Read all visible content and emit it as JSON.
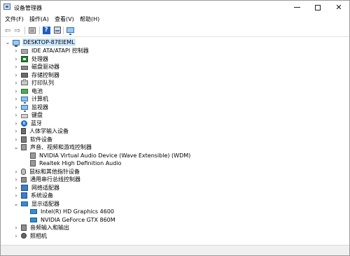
{
  "window": {
    "title": "设备管理器",
    "icon": "device-manager-icon",
    "controls": {
      "minimize": "minimize-icon",
      "maximize": "maximize-icon",
      "close": "✕"
    }
  },
  "menu": [
    "文件(F)",
    "操作(A)",
    "查看(V)",
    "帮助(H)"
  ],
  "toolbar": {
    "buttons": [
      "back-arrow-icon",
      "forward-arrow-icon",
      "properties-icon",
      "help-icon",
      "scan-hardware-icon",
      "monitor-icon"
    ],
    "back_glyph": "⇦",
    "forward_glyph": "⇨",
    "help_glyph": "?"
  },
  "tree": {
    "root": {
      "label": "DESKTOP-87EIEML",
      "expanded": true
    },
    "items": [
      {
        "label": "IDE ATA/ATAPI 控制器",
        "icon": "ide-controller-icon",
        "expanded": false
      },
      {
        "label": "处理器",
        "icon": "processor-icon",
        "expanded": false
      },
      {
        "label": "磁盘驱动器",
        "icon": "disk-drive-icon",
        "expanded": false
      },
      {
        "label": "存储控制器",
        "icon": "storage-controller-icon",
        "expanded": false
      },
      {
        "label": "打印队列",
        "icon": "printer-icon",
        "expanded": false
      },
      {
        "label": "电池",
        "icon": "battery-icon",
        "expanded": false
      },
      {
        "label": "计算机",
        "icon": "computer-icon",
        "expanded": false
      },
      {
        "label": "监视器",
        "icon": "monitor-icon",
        "expanded": false
      },
      {
        "label": "键盘",
        "icon": "keyboard-icon",
        "expanded": false
      },
      {
        "label": "蓝牙",
        "icon": "bluetooth-icon",
        "expanded": false
      },
      {
        "label": "人体学输入设备",
        "icon": "hid-icon",
        "expanded": false
      },
      {
        "label": "软件设备",
        "icon": "software-device-icon",
        "expanded": false
      },
      {
        "label": "声音、视频和游戏控制器",
        "icon": "sound-icon",
        "expanded": true,
        "children": [
          {
            "label": "NVIDIA Virtual Audio Device (Wave Extensible) (WDM)",
            "icon": "speaker-icon"
          },
          {
            "label": "Realtek High Definition Audio",
            "icon": "speaker-icon"
          }
        ]
      },
      {
        "label": "鼠标和其他指针设备",
        "icon": "mouse-icon",
        "expanded": false
      },
      {
        "label": "通用串行总线控制器",
        "icon": "usb-icon",
        "expanded": false
      },
      {
        "label": "网络适配器",
        "icon": "network-adapter-icon",
        "expanded": false
      },
      {
        "label": "系统设备",
        "icon": "system-device-icon",
        "expanded": false
      },
      {
        "label": "显示适配器",
        "icon": "display-adapter-icon",
        "expanded": true,
        "children": [
          {
            "label": "Intel(R) HD Graphics 4600",
            "icon": "display-adapter-icon"
          },
          {
            "label": "NVIDIA GeForce GTX 860M",
            "icon": "display-adapter-icon"
          }
        ]
      },
      {
        "label": "音频输入和输出",
        "icon": "audio-io-icon",
        "expanded": false
      },
      {
        "label": "照相机",
        "icon": "camera-icon",
        "expanded": false
      }
    ]
  },
  "colors": {
    "selection": "#cce8ff",
    "accent": "#2b6fb6",
    "statusbar": "#f0f0f0"
  }
}
